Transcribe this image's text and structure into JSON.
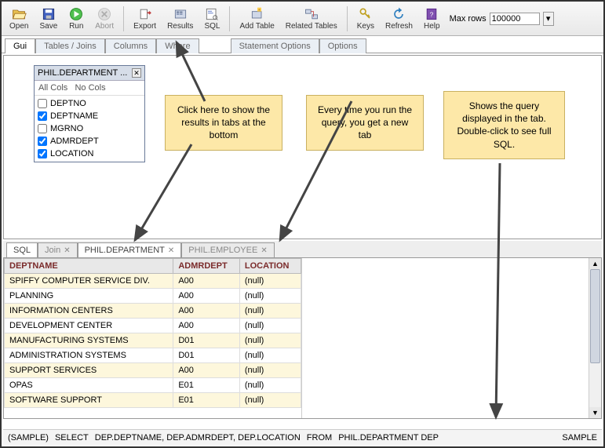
{
  "toolbar": {
    "open": "Open",
    "save": "Save",
    "run": "Run",
    "abort": "Abort",
    "export": "Export",
    "results": "Results",
    "sql": "SQL",
    "addtable": "Add Table",
    "reltables": "Related Tables",
    "keys": "Keys",
    "refresh": "Refresh",
    "help": "Help",
    "maxrows_label": "Max rows",
    "maxrows_value": "100000"
  },
  "upperTabs": {
    "gui": "Gui",
    "tables": "Tables / Joins",
    "columns": "Columns",
    "where": "Where",
    "stmt": "Statement Options",
    "options": "Options"
  },
  "tablebox": {
    "title": "PHIL.DEPARTMENT ...",
    "allcols": "All Cols",
    "nocols": "No Cols",
    "columns": [
      {
        "name": "DEPTNO",
        "checked": false
      },
      {
        "name": "DEPTNAME",
        "checked": true
      },
      {
        "name": "MGRNO",
        "checked": false
      },
      {
        "name": "ADMRDEPT",
        "checked": true
      },
      {
        "name": "LOCATION",
        "checked": true
      }
    ]
  },
  "callouts": {
    "results": "Click here to show the results in tabs at the bottom",
    "run": "Every time you run the query, you get a new tab",
    "tab": "Shows the query displayed in the tab. Double-click to see full SQL."
  },
  "lowerTabs": {
    "sql": "SQL",
    "join": "Join",
    "dept": "PHIL.DEPARTMENT",
    "emp": "PHIL.EMPLOYEE"
  },
  "results": {
    "headers": [
      "DEPTNAME",
      "ADMRDEPT",
      "LOCATION"
    ],
    "rows": [
      [
        "SPIFFY COMPUTER SERVICE DIV.",
        "A00",
        "(null)"
      ],
      [
        "PLANNING",
        "A00",
        "(null)"
      ],
      [
        "INFORMATION CENTERS",
        "A00",
        "(null)"
      ],
      [
        "DEVELOPMENT CENTER",
        "A00",
        "(null)"
      ],
      [
        "MANUFACTURING SYSTEMS",
        "D01",
        "(null)"
      ],
      [
        "ADMINISTRATION SYSTEMS",
        "D01",
        "(null)"
      ],
      [
        "SUPPORT SERVICES",
        "A00",
        "(null)"
      ],
      [
        "OPAS",
        "E01",
        "(null)"
      ],
      [
        "SOFTWARE SUPPORT",
        "E01",
        "(null)"
      ]
    ]
  },
  "status": {
    "sample": "(SAMPLE)",
    "select": "SELECT",
    "cols": "DEP.DEPTNAME, DEP.ADMRDEPT, DEP.LOCATION",
    "from": "FROM",
    "table": "PHIL.DEPARTMENT DEP",
    "db": "SAMPLE"
  }
}
